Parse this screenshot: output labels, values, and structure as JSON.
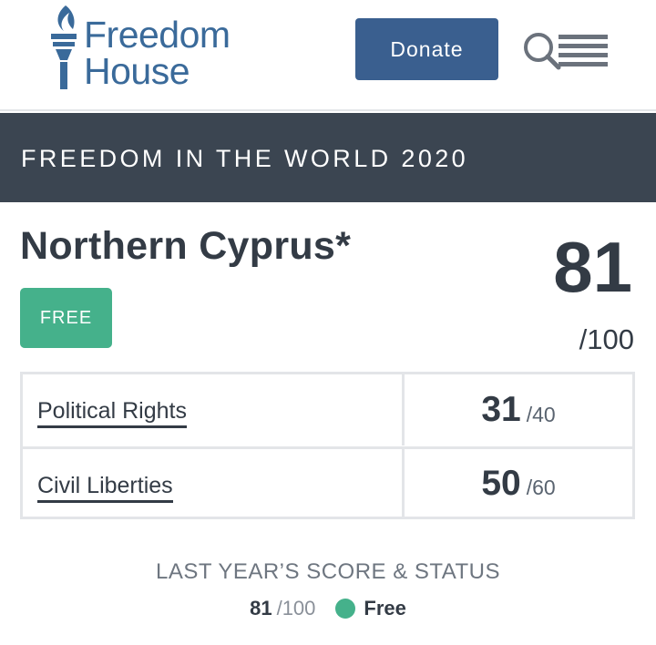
{
  "header": {
    "logo_line1": "Freedom",
    "logo_line2": "House",
    "donate_label": "Donate",
    "icons": [
      "torch-logo-icon",
      "search-icon",
      "menu-icon"
    ]
  },
  "banner": {
    "title": "FREEDOM IN THE WORLD 2020"
  },
  "country": {
    "name": "Northern Cyprus*",
    "status": "FREE",
    "total_score": "81",
    "total_max": "/100"
  },
  "scores": [
    {
      "label": "Political Rights",
      "score": "31",
      "max": "/40"
    },
    {
      "label": "Civil Liberties",
      "score": "50",
      "max": "/60"
    }
  ],
  "last_year": {
    "title": "LAST YEAR’S SCORE & STATUS",
    "score": "81",
    "max": "/100",
    "status": "Free"
  },
  "colors": {
    "brand_blue": "#3a6a9a",
    "donate_bg": "#3a5f8f",
    "banner_bg": "#3b4551",
    "free_green": "#45b18b"
  }
}
